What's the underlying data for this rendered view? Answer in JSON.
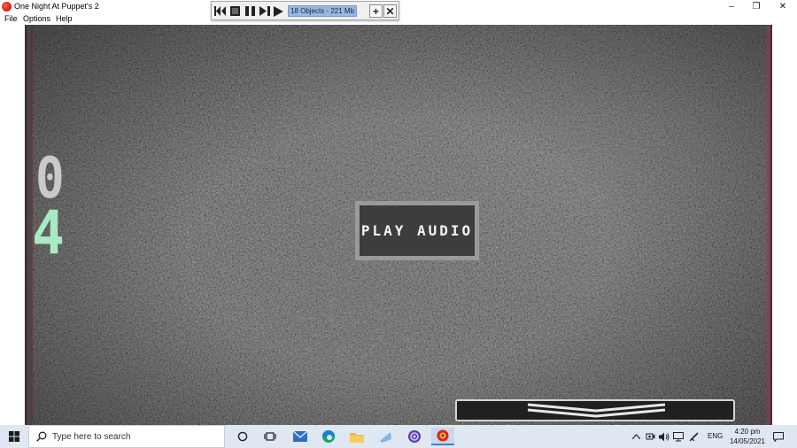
{
  "window": {
    "title": "One Night At Puppet's 2",
    "minimize": "–",
    "maximize": "❐",
    "close": "✕"
  },
  "menu": {
    "items": [
      "File",
      "Options",
      "Help"
    ]
  },
  "debug_toolbar": {
    "counter": "18 Objects - 221 Mb",
    "plus": "+",
    "close": "✕"
  },
  "game": {
    "digit_top": "0",
    "digit_bottom": "4",
    "play_button": "PLAY AUDIO"
  },
  "taskbar": {
    "search_placeholder": "Type here to search",
    "language": "ENG",
    "time": "4:20 pm",
    "date": "14/05/2021"
  },
  "colors": {
    "digit_top": "#c9c9c9",
    "digit_bottom": "#a9e9c4",
    "taskbar": "#dfe7f2",
    "toolbar_counter": "#9ab8dd"
  }
}
